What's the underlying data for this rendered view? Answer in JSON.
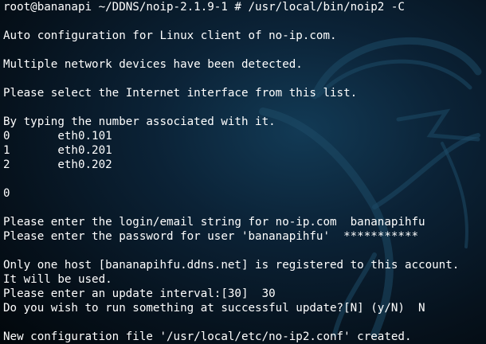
{
  "terminal": {
    "lines": [
      "root@bananapi ~/DDNS/noip-2.1.9-1 # /usr/local/bin/noip2 -C",
      "",
      "Auto configuration for Linux client of no-ip.com.",
      "",
      "Multiple network devices have been detected.",
      "",
      "Please select the Internet interface from this list.",
      "",
      "By typing the number associated with it.",
      "0       eth0.101",
      "1       eth0.201",
      "2       eth0.202",
      "",
      "0",
      "",
      "Please enter the login/email string for no-ip.com  bananapihfu",
      "Please enter the password for user 'bananapihfu'  ***********",
      "",
      "Only one host [bananapihfu.ddns.net] is registered to this account.",
      "It will be used.",
      "Please enter an update interval:[30]  30",
      "Do you wish to run something at successful update?[N] (y/N)  N",
      "",
      "New configuration file '/usr/local/etc/no-ip2.conf' created."
    ]
  },
  "background": {
    "logo_icon": "kali-dragon-icon",
    "color": "#0b2236"
  }
}
